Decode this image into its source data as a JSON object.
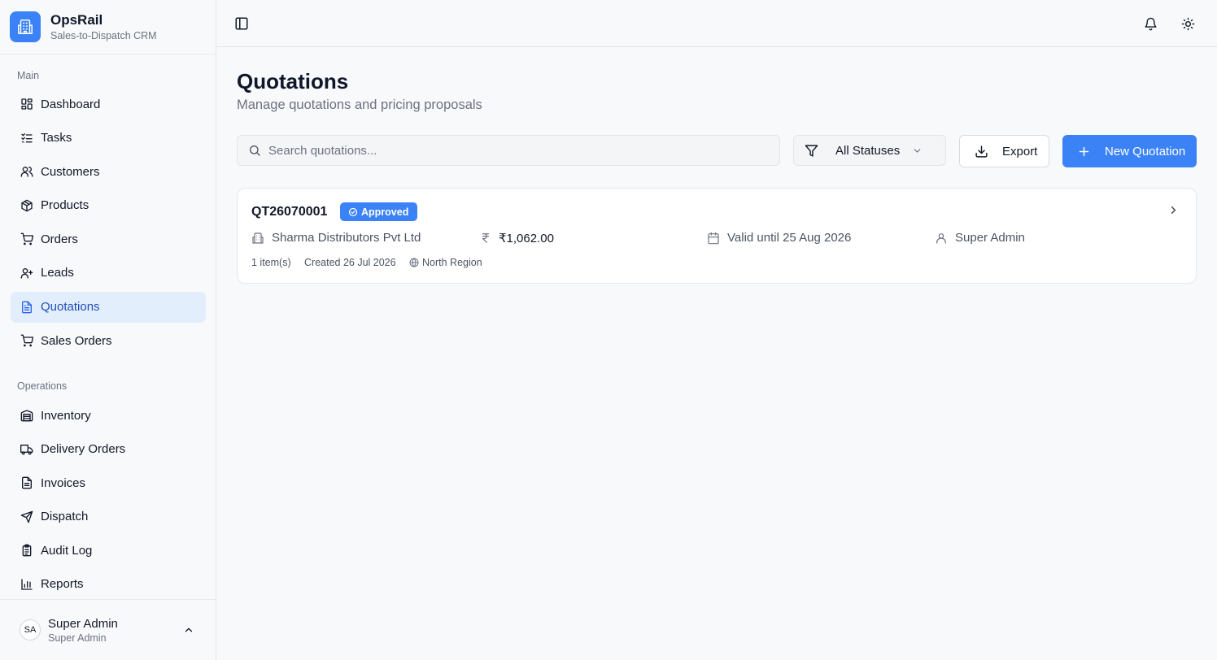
{
  "brand": {
    "name": "OpsRail",
    "tagline": "Sales-to-Dispatch CRM"
  },
  "sidebar": {
    "sections": [
      {
        "label": "Main",
        "items": [
          {
            "label": "Dashboard",
            "icon": "dashboard-icon"
          },
          {
            "label": "Tasks",
            "icon": "tasks-icon"
          },
          {
            "label": "Customers",
            "icon": "users-icon"
          },
          {
            "label": "Products",
            "icon": "box-icon"
          },
          {
            "label": "Orders",
            "icon": "cart-icon"
          },
          {
            "label": "Leads",
            "icon": "user-plus-icon"
          },
          {
            "label": "Quotations",
            "icon": "document-icon",
            "active": true
          },
          {
            "label": "Sales Orders",
            "icon": "cart-icon"
          }
        ]
      },
      {
        "label": "Operations",
        "items": [
          {
            "label": "Inventory",
            "icon": "warehouse-icon"
          },
          {
            "label": "Delivery Orders",
            "icon": "truck-icon"
          },
          {
            "label": "Invoices",
            "icon": "file-icon"
          },
          {
            "label": "Dispatch",
            "icon": "send-icon"
          },
          {
            "label": "Audit Log",
            "icon": "clipboard-icon"
          },
          {
            "label": "Reports",
            "icon": "bar-chart-icon"
          }
        ]
      }
    ],
    "user": {
      "initials": "SA",
      "name": "Super Admin",
      "role": "Super Admin"
    }
  },
  "page": {
    "title": "Quotations",
    "subtitle": "Manage quotations and pricing proposals"
  },
  "toolbar": {
    "search_placeholder": "Search quotations...",
    "status_filter": "All Statuses",
    "export_label": "Export",
    "new_label": "New Quotation"
  },
  "quotations": [
    {
      "number": "QT26070001",
      "status": "Approved",
      "customer": "Sharma Distributors Pvt Ltd",
      "amount": "₹1,062.00",
      "valid_until": "Valid until 25 Aug 2026",
      "owner": "Super Admin",
      "items": "1 item(s)",
      "created": "Created 26 Jul 2026",
      "region": "North Region"
    }
  ],
  "colors": {
    "accent": "#3b82f6",
    "active_bg": "#e3eefd",
    "active_text": "#1e4fb8"
  }
}
